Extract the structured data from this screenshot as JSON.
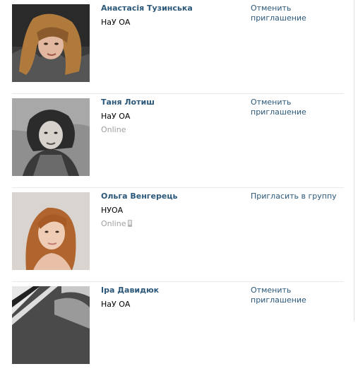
{
  "people": [
    {
      "name": "Анастасія Тузинська",
      "university": "НаУ ОА",
      "status": "",
      "action": "Отменить приглашение",
      "mobile": false
    },
    {
      "name": "Таня Лотиш",
      "university": "НаУ ОА",
      "status": "Online",
      "action": "Отменить приглашение",
      "mobile": false
    },
    {
      "name": "Ольга Венгерець",
      "university": "НУОА",
      "status": "Online",
      "action": "Пригласить в группу",
      "mobile": true
    },
    {
      "name": "Іра Давидюк",
      "university": "НаУ ОА",
      "status": "",
      "action": "Отменить приглашение",
      "mobile": false
    }
  ],
  "colors": {
    "link": "#2b587a",
    "muted": "#a0a0a0",
    "separator": "#e7e8ec"
  }
}
